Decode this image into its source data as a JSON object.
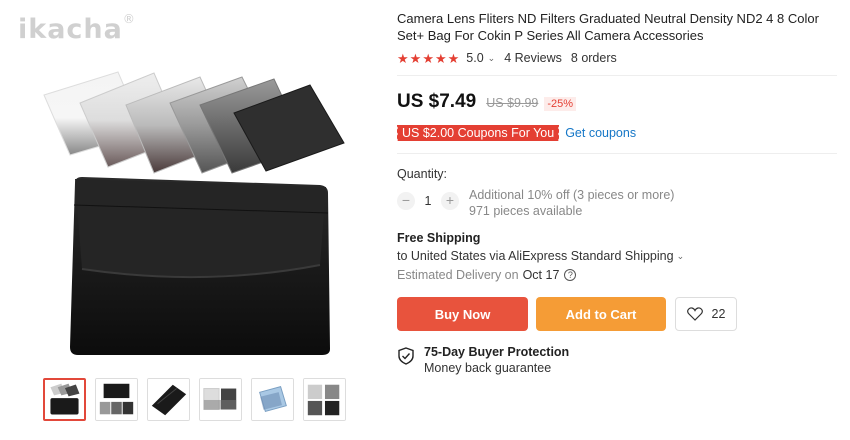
{
  "watermark": {
    "brand": "ikacha",
    "mark": "®"
  },
  "product": {
    "title": "Camera Lens Fliters ND Filters Graduated Neutral Density ND2 4 8 Color Set+ Bag For Cokin P Series All Camera Accessories",
    "rating": "5.0",
    "rating_caret": "⌄",
    "reviews": "4 Reviews",
    "orders": "8 orders"
  },
  "price": {
    "current": "US $7.49",
    "original": "US $9.99",
    "discount": "-25%"
  },
  "coupon": {
    "label": "US $2.00 Coupons For You",
    "link": "Get coupons"
  },
  "quantity": {
    "label": "Quantity:",
    "minus": "−",
    "value": "1",
    "plus": "+",
    "offer": "Additional 10% off (3 pieces or more)",
    "available": "971 pieces available"
  },
  "shipping": {
    "title": "Free Shipping",
    "line": "to United States via AliExpress Standard Shipping",
    "caret": "⌄",
    "estimate_label": "Estimated Delivery on",
    "estimate_date": "Oct 17",
    "help_icon": "?"
  },
  "actions": {
    "buy_now": "Buy Now",
    "add_to_cart": "Add to Cart",
    "wishlist_count": "22"
  },
  "protection": {
    "title": "75-Day Buyer Protection",
    "subtitle": "Money back guarantee"
  },
  "icons": {
    "star": "star-icon",
    "heart": "heart-icon",
    "shield": "shield-check-icon",
    "help": "question-circle-icon"
  },
  "colors": {
    "accent_red": "#e43f33",
    "buy_now": "#e8533d",
    "add_to_cart": "#f59c36",
    "link_blue": "#1677c7"
  }
}
